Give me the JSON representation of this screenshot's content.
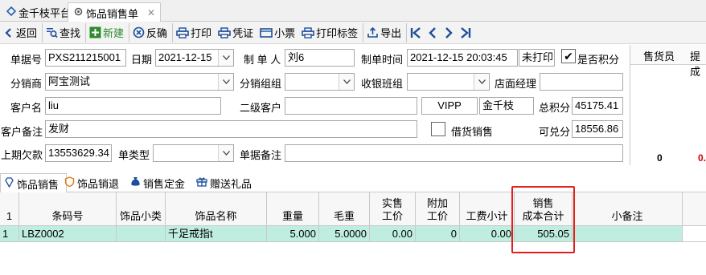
{
  "window_tabs": [
    {
      "label": "金千枝平台"
    },
    {
      "label": "饰品销售单"
    }
  ],
  "toolbar": {
    "back": "返回",
    "find": "查找",
    "new": "新建",
    "uncheck": "反确",
    "print": "打印",
    "voucher": "凭证",
    "ticket": "小票",
    "print_label": "打印标签",
    "export": "导出"
  },
  "form": {
    "bill_no": {
      "label": "单据号",
      "value": "PXS211215001"
    },
    "date": {
      "label": "日期",
      "value": "2021-12-15"
    },
    "maker": {
      "label": "制 单 人",
      "value": "刘6"
    },
    "make_time": {
      "label": "制单时间",
      "value": "2021-12-15 20:03:45"
    },
    "print_status": "未打印",
    "points": {
      "label": "是否积分",
      "checked": true
    },
    "distributor": {
      "label": "分销商",
      "value": "阿宝测试"
    },
    "dist_group": {
      "label": "分销组组",
      "value": ""
    },
    "cashier_group": {
      "label": "收银班组",
      "value": ""
    },
    "store_manager": {
      "label": "店面经理",
      "value": ""
    },
    "customer": {
      "label": "客户名",
      "value": "liu"
    },
    "sub_customer": {
      "label": "二级客户",
      "value": ""
    },
    "level": "VIPP",
    "brand": "金千枝",
    "total_points": {
      "label": "总积分",
      "value": "45175.41"
    },
    "customer_note": {
      "label": "客户备注",
      "value": "发财"
    },
    "borrow_sale": {
      "label": "借货销售",
      "checked": false
    },
    "redeemable": {
      "label": "可兑分",
      "value": "18556.86"
    },
    "prev_debt": {
      "label": "上期欠款",
      "value": "13553629.34"
    },
    "bill_type": {
      "label": "单类型",
      "value": ""
    },
    "bill_note": {
      "label": "单据备注",
      "value": ""
    }
  },
  "sales_panel": {
    "headers": [
      "售货员",
      "提成"
    ],
    "values": [
      "0",
      "0."
    ]
  },
  "lower_tabs": [
    {
      "label": "饰品销售"
    },
    {
      "label": "饰品销退"
    },
    {
      "label": "销售定金"
    },
    {
      "label": "赠送礼品"
    }
  ],
  "grid": {
    "headers": [
      "1",
      "条码号",
      "饰品小类",
      "饰品名称",
      "重量",
      "毛重",
      "实售\n工价",
      "附加\n工价",
      "工费小计",
      "销售\n成本合计",
      "小备注"
    ],
    "rows": [
      [
        "1",
        "LBZ0002",
        "",
        "千足戒指t",
        "5.000",
        "5.0000",
        "0.00",
        "0",
        "0.00",
        "505.05",
        ""
      ]
    ]
  },
  "colors": {
    "row_highlight": "#bfeee0",
    "annotation": "#e02020"
  }
}
